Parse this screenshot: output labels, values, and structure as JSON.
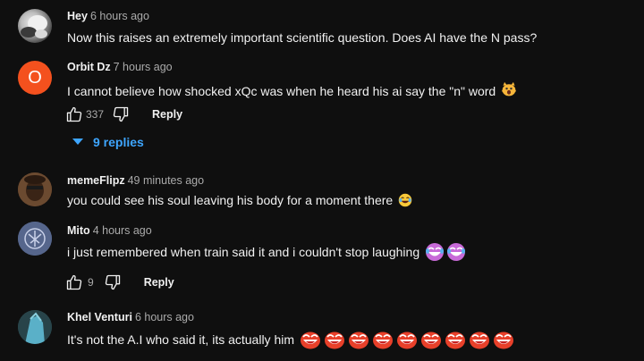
{
  "comments": [
    {
      "author": "Hey",
      "time": "6 hours ago",
      "text": "Now this raises an extremely important scientific question. Does AI have the N pass?"
    },
    {
      "author": "Orbit Dz",
      "time": "7 hours ago",
      "text": "I cannot believe how shocked xQc was when he heard his ai say the \"n\" word",
      "avatar_letter": "O",
      "avatar_color": "#f4511e",
      "likes": "337",
      "reply_label": "Reply",
      "replies_label": "9 replies",
      "emoji": "scream-cat-emoji"
    },
    {
      "author": "memeFlipz",
      "time": "49 minutes ago",
      "text": "you could see his soul leaving his body for a moment there",
      "emoji": "laughing-emoji"
    },
    {
      "author": "Mito",
      "time": "4 hours ago",
      "text": "i just remembered when train said it and i couldn't stop laughing",
      "likes": "9",
      "reply_label": "Reply",
      "emoji": "laughing-purple-emoji",
      "emoji_count": 2
    },
    {
      "author": "Khel Venturi",
      "time": "6 hours ago",
      "text": "It's not the A.I who said it, its actually him",
      "emoji": "laughing-red-emoji",
      "emoji_count": 9
    }
  ],
  "colors": {
    "background": "#0f0f0f",
    "link": "#3ea6ff",
    "secondary_text": "#aaaaaa"
  },
  "icons": [
    "like-icon",
    "dislike-icon",
    "chevron-down-icon"
  ]
}
